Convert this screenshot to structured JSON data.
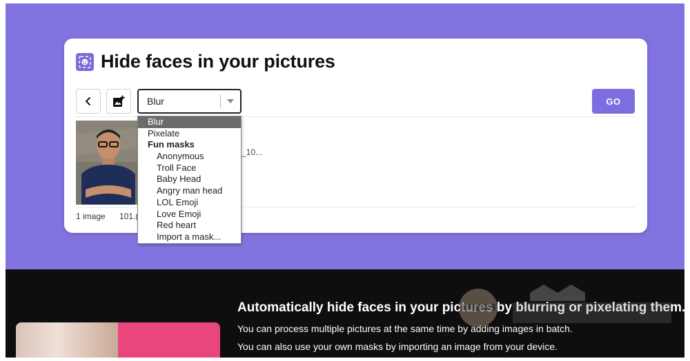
{
  "app": {
    "title": "Hide faces in your pictures"
  },
  "toolbar": {
    "back_icon": "chevron-left-icon",
    "add_image_icon": "add-photo-icon",
    "effect_select": {
      "selected": "Blur",
      "options": [
        {
          "label": "Blur",
          "selected": true
        },
        {
          "label": "Pixelate"
        }
      ],
      "groups": [
        {
          "label": "Fun masks",
          "options": [
            {
              "label": "Anonymous"
            },
            {
              "label": "Troll Face"
            },
            {
              "label": "Baby Head"
            },
            {
              "label": "Angry man head"
            },
            {
              "label": "LOL Emoji"
            },
            {
              "label": "Love Emoji"
            },
            {
              "label": "Red heart"
            },
            {
              "label": "Import a mask..."
            }
          ]
        }
      ]
    },
    "go_label": "GO"
  },
  "images": {
    "filename_fragment": "_10...",
    "count_label": "1 image",
    "size_fragment": "101.("
  },
  "promo": {
    "title": "Automatically hide faces in your pictures by blurring or pixelating them.",
    "line1": "You can process multiple pictures at the same time by adding images in batch.",
    "line2": "You can also use your own masks by importing an image from your device."
  },
  "colors": {
    "background": "#8274e0",
    "accent": "#7c6ee0",
    "dark": "#0e0e10"
  }
}
